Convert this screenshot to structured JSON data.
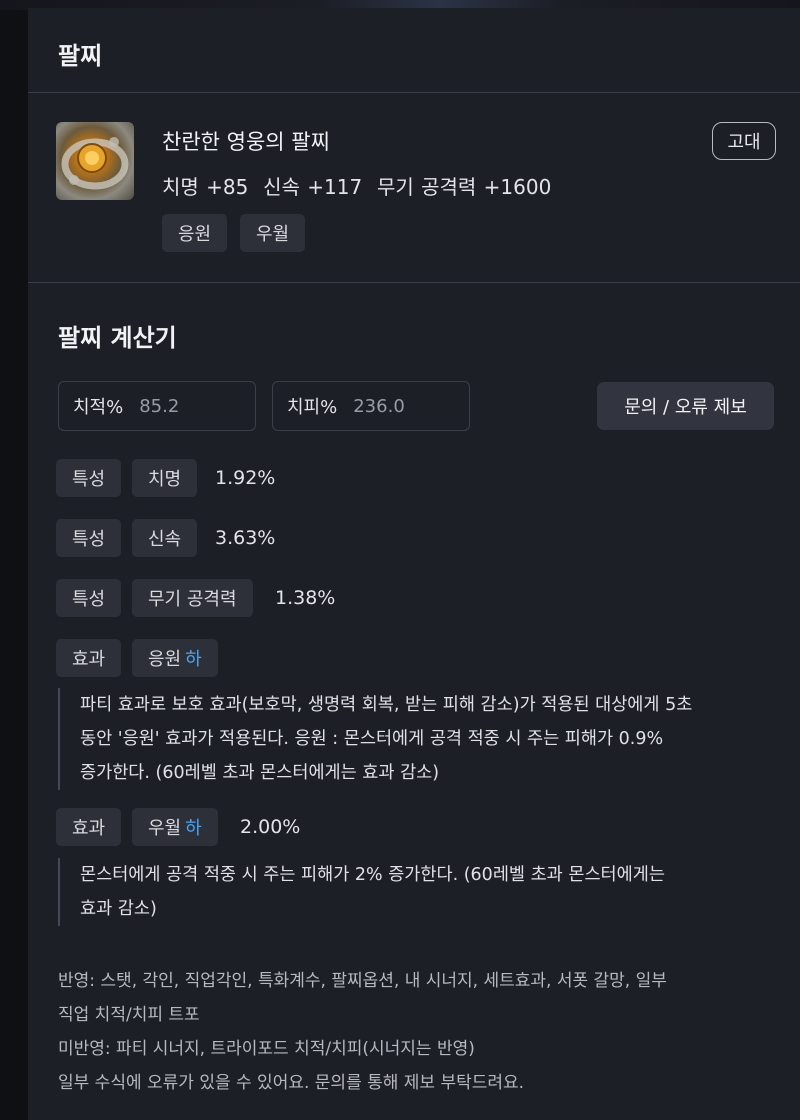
{
  "header": {
    "title": "팔찌"
  },
  "item": {
    "name": "찬란한 영웅의 팔찌",
    "grade": "고대",
    "stats": [
      {
        "label": "치명",
        "value": "+85"
      },
      {
        "label": "신속",
        "value": "+117"
      },
      {
        "label": "무기 공격력",
        "value": "+1600"
      }
    ],
    "tags": [
      "응원",
      "우월"
    ],
    "icon": "bracelet-icon"
  },
  "calculator": {
    "title": "팔찌 계산기",
    "crit_rate": {
      "label": "치적%",
      "value": "85.2"
    },
    "crit_damage": {
      "label": "치피%",
      "value": "236.0"
    },
    "report_button": "문의 / 오류 제보",
    "traits": [
      {
        "type": "특성",
        "name": "치명",
        "value": "1.92%"
      },
      {
        "type": "특성",
        "name": "신속",
        "value": "3.63%"
      },
      {
        "type": "특성",
        "name": "무기 공격력",
        "value": "1.38%"
      }
    ],
    "effects": [
      {
        "type": "효과",
        "name": "응원",
        "grade": "하",
        "value": "",
        "desc_lines": [
          "파티 효과로 보호 효과(보호막, 생명력 회복, 받는 피해 감소)가 적용된 대상에게 5초",
          "동안 '응원' 효과가 적용된다. 응원 : 몬스터에게 공격 적중 시 주는 피해가 0.9%",
          "증가한다. (60레벨 초과 몬스터에게는 효과 감소)"
        ]
      },
      {
        "type": "효과",
        "name": "우월",
        "grade": "하",
        "value": "2.00%",
        "desc_lines": [
          "몬스터에게 공격 적중 시 주는 피해가 2% 증가한다. (60레벨 초과 몬스터에게는",
          "효과 감소)"
        ]
      }
    ],
    "notes": [
      "반영: 스탯, 각인, 직업각인, 특화계수, 팔찌옵션, 내 시너지, 세트효과, 서폿 갈망, 일부",
      "직업 치적/치피 트포",
      "미반영: 파티 시너지, 트라이포드 치적/치피(시너지는 반영)",
      "일부 수식에 오류가 있을 수 있어요. 문의를 통해 제보 부탁드려요."
    ],
    "accent_color": "#4aa3f2"
  }
}
